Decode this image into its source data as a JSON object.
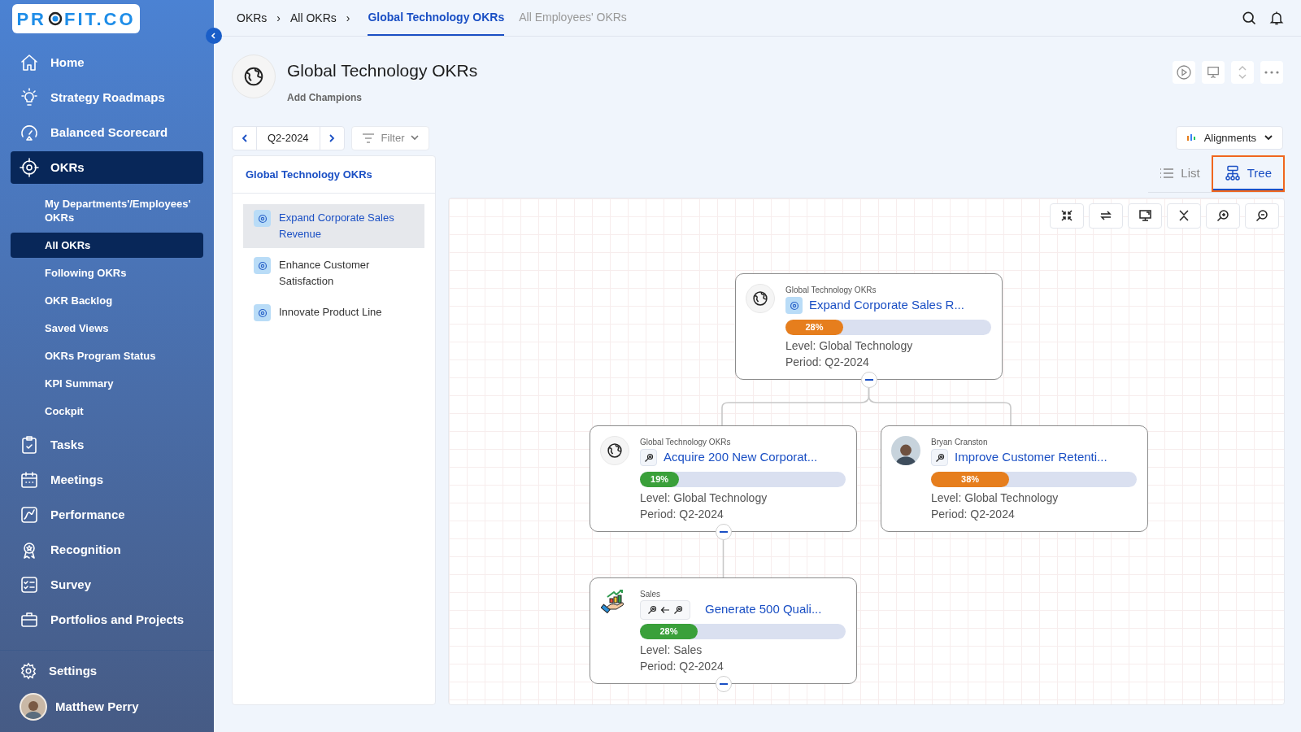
{
  "logo": {
    "before": "PR",
    "after": "FIT.CO"
  },
  "sidebar": {
    "items": [
      {
        "label": "Home",
        "selected": false
      },
      {
        "label": "Strategy Roadmaps",
        "selected": false
      },
      {
        "label": "Balanced Scorecard",
        "selected": false
      },
      {
        "label": "OKRs",
        "selected": true,
        "children": [
          {
            "label": "My Departments'/Employees' OKRs",
            "selected": false
          },
          {
            "label": "All OKRs",
            "selected": true
          },
          {
            "label": "Following OKRs",
            "selected": false
          },
          {
            "label": "OKR Backlog",
            "selected": false
          },
          {
            "label": "Saved Views",
            "selected": false
          },
          {
            "label": "OKRs Program Status",
            "selected": false
          },
          {
            "label": "KPI Summary",
            "selected": false
          },
          {
            "label": "Cockpit",
            "selected": false
          }
        ]
      },
      {
        "label": "Tasks",
        "selected": false
      },
      {
        "label": "Meetings",
        "selected": false
      },
      {
        "label": "Performance",
        "selected": false
      },
      {
        "label": "Recognition",
        "selected": false
      },
      {
        "label": "Survey",
        "selected": false
      },
      {
        "label": "Portfolios and Projects",
        "selected": false
      }
    ],
    "settings": "Settings",
    "user": "Matthew Perry"
  },
  "breadcrumbs": [
    {
      "label": "OKRs",
      "separator": "›"
    },
    {
      "label": "All OKRs",
      "separator": "›"
    }
  ],
  "tabs": [
    {
      "label": "Global Technology OKRs",
      "selected": true
    },
    {
      "label": "All Employees' OKRs",
      "selected": false
    }
  ],
  "header": {
    "title": "Global Technology OKRs",
    "subtitle": "Add Champions"
  },
  "period": "Q2-2024",
  "filter": "Filter",
  "alignments": "Alignments",
  "objectives_panel": {
    "title": "Global Technology OKRs",
    "items": [
      {
        "label": "Expand Corporate Sales Revenue",
        "selected": true
      },
      {
        "label": "Enhance Customer Satisfaction",
        "selected": false
      },
      {
        "label": "Innovate Product Line",
        "selected": false
      }
    ]
  },
  "view_tabs": [
    {
      "label": "List",
      "selected": false
    },
    {
      "label": "Tree",
      "selected": true
    }
  ],
  "tree": {
    "kind": "objective",
    "owner": "Global Technology OKRs",
    "title": "Expand Corporate Sales R...",
    "level": 0.28,
    "progress": "28%",
    "color": "#e67e1d",
    "level_text": "Level: Global Technology",
    "period_text": "Period: Q2-2024",
    "expanded": true,
    "children": [
      {
        "kind": "keyresult",
        "owner": "Global Technology OKRs",
        "title": "Acquire 200 New Corporat...",
        "level": 0.19,
        "progress": "19%",
        "color": "#3aa03a",
        "level_text": "Level: Global Technology",
        "period_text": "Period: Q2-2024",
        "expanded": true,
        "children": [
          {
            "kind": "aligned",
            "owner": "Sales",
            "title": "Generate 500 Quali...",
            "level": 0.28,
            "progress": "28%",
            "color": "#3aa03a",
            "level_text": "Level: Sales",
            "period_text": "Period: Q2-2024",
            "expanded": true
          }
        ]
      },
      {
        "kind": "personal",
        "owner": "Bryan Cranston",
        "title": "Improve Customer Retenti...",
        "level": 0.38,
        "progress": "38%",
        "color": "#e67e1d",
        "level_text": "Level: Global Technology",
        "period_text": "Period: Q2-2024",
        "expanded": false
      }
    ]
  }
}
